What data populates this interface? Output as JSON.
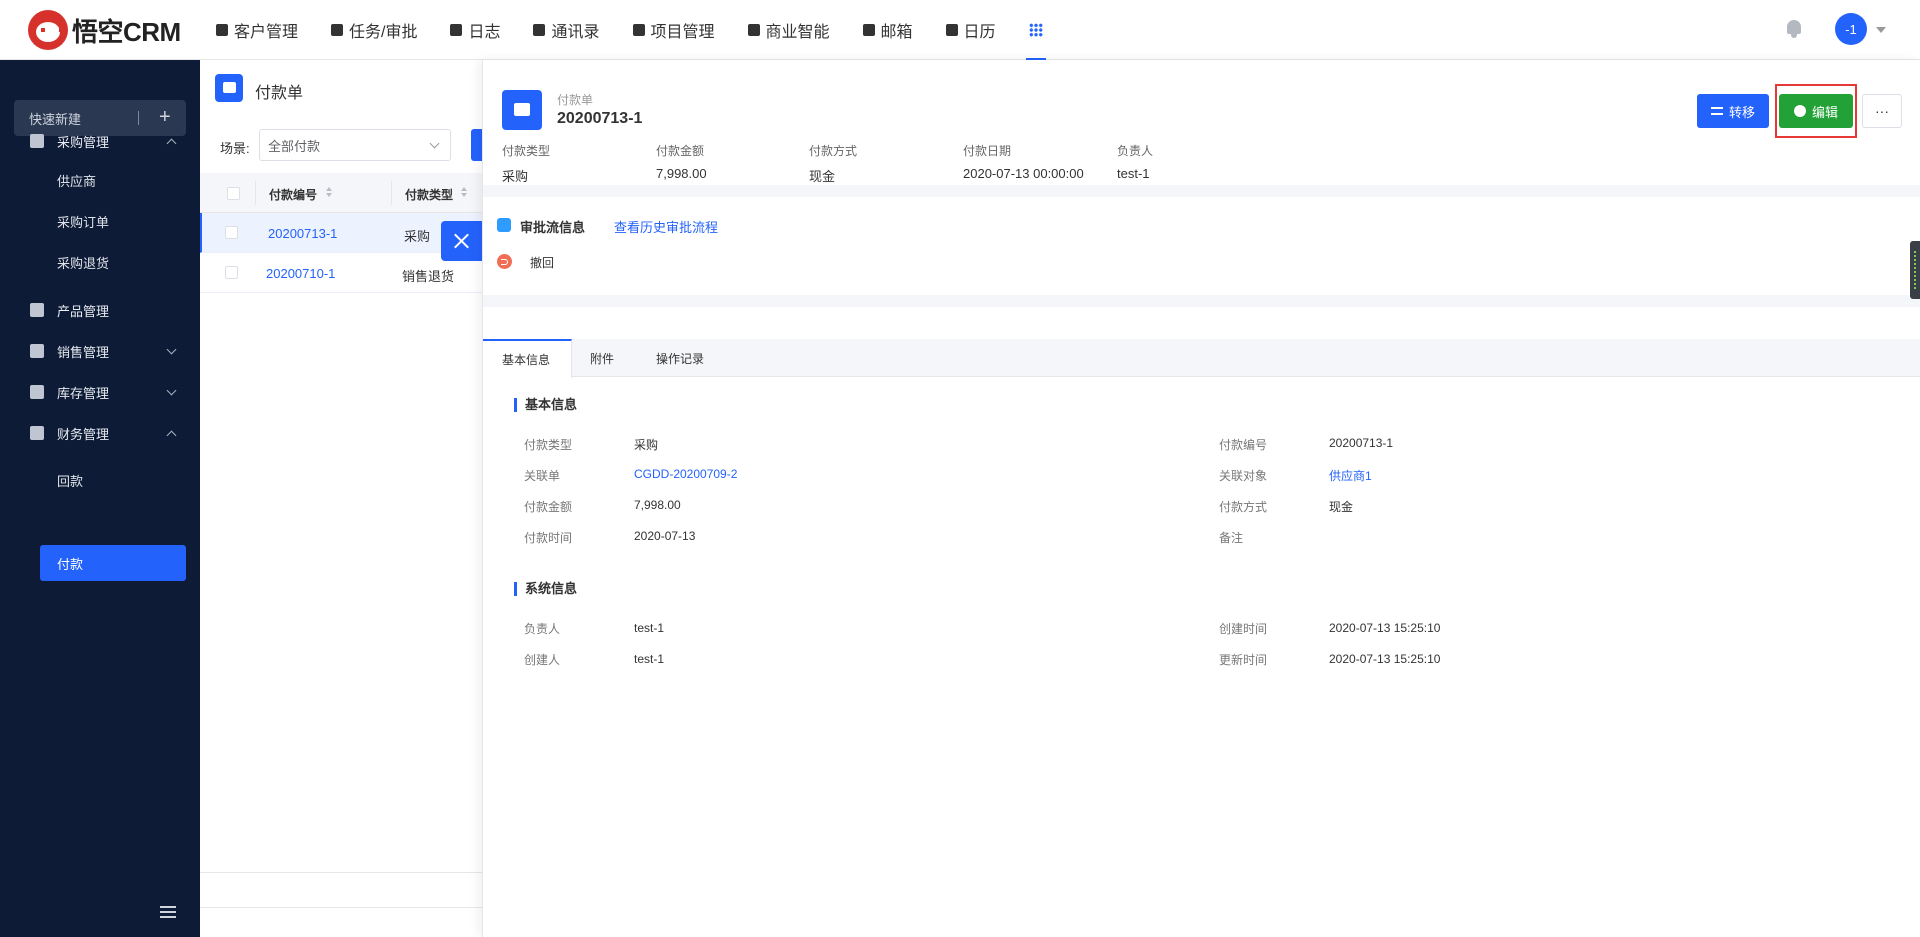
{
  "topbar": {
    "logo_text": "悟空CRM",
    "nav": [
      {
        "label": "客户管理",
        "icon": "building-icon"
      },
      {
        "label": "任务/审批",
        "icon": "briefcase-icon"
      },
      {
        "label": "日志",
        "icon": "notebook-icon"
      },
      {
        "label": "通讯录",
        "icon": "contacts-icon"
      },
      {
        "label": "项目管理",
        "icon": "list-icon"
      },
      {
        "label": "商业智能",
        "icon": "chart-icon"
      },
      {
        "label": "邮箱",
        "icon": "mail-icon"
      },
      {
        "label": "日历",
        "icon": "calendar-icon"
      }
    ],
    "avatar_text": "-1",
    "accent": "#2362fb"
  },
  "sidebar": {
    "quick_new": "快速新建",
    "menus": [
      {
        "label": "采购管理",
        "icon": "cart-icon",
        "expanded": true
      },
      {
        "label": "产品管理",
        "icon": "box-icon"
      },
      {
        "label": "销售管理",
        "icon": "tag-icon",
        "expanded": false
      },
      {
        "label": "库存管理",
        "icon": "warehouse-icon",
        "expanded": false
      },
      {
        "label": "财务管理",
        "icon": "wallet-icon",
        "expanded": true
      }
    ],
    "purchase_sub": [
      "供应商",
      "采购订单",
      "采购退货"
    ],
    "finance_sub": [
      "回款",
      "付款"
    ]
  },
  "list": {
    "title": "付款单",
    "scene_label": "场景:",
    "scene_value": "全部付款",
    "columns": [
      "付款编号",
      "付款类型"
    ],
    "rows": [
      {
        "no": "20200713-1",
        "type": "采购"
      },
      {
        "no": "20200710-1",
        "type": "销售退货"
      }
    ]
  },
  "detail": {
    "type_label": "付款单",
    "title": "20200713-1",
    "buttons": {
      "transfer": "转移",
      "edit": "编辑",
      "more": "···"
    },
    "summary": [
      {
        "label": "付款类型",
        "value": "采购"
      },
      {
        "label": "付款金额",
        "value": "7,998.00"
      },
      {
        "label": "付款方式",
        "value": "现金"
      },
      {
        "label": "付款日期",
        "value": "2020-07-13 00:00:00"
      },
      {
        "label": "负责人",
        "value": "test-1"
      }
    ],
    "approval": {
      "title": "审批流信息",
      "history_link": "查看历史审批流程",
      "action": "撤回"
    },
    "tabs": [
      "基本信息",
      "附件",
      "操作记录"
    ],
    "basic": {
      "title": "基本信息",
      "left": [
        {
          "label": "付款类型",
          "value": "采购"
        },
        {
          "label": "关联单",
          "value": "CGDD-20200709-2"
        },
        {
          "label": "付款金额",
          "value": "7,998.00"
        },
        {
          "label": "付款时间",
          "value": "2020-07-13"
        }
      ],
      "right": [
        {
          "label": "付款编号",
          "value": "20200713-1"
        },
        {
          "label": "关联对象",
          "value": "供应商1"
        },
        {
          "label": "付款方式",
          "value": "现金"
        },
        {
          "label": "备注",
          "value": ""
        }
      ]
    },
    "system": {
      "title": "系统信息",
      "left": [
        {
          "label": "负责人",
          "value": "test-1"
        },
        {
          "label": "创建人",
          "value": "test-1"
        }
      ],
      "right": [
        {
          "label": "创建时间",
          "value": "2020-07-13 15:25:10"
        },
        {
          "label": "更新时间",
          "value": "2020-07-13 15:25:10"
        }
      ]
    }
  }
}
